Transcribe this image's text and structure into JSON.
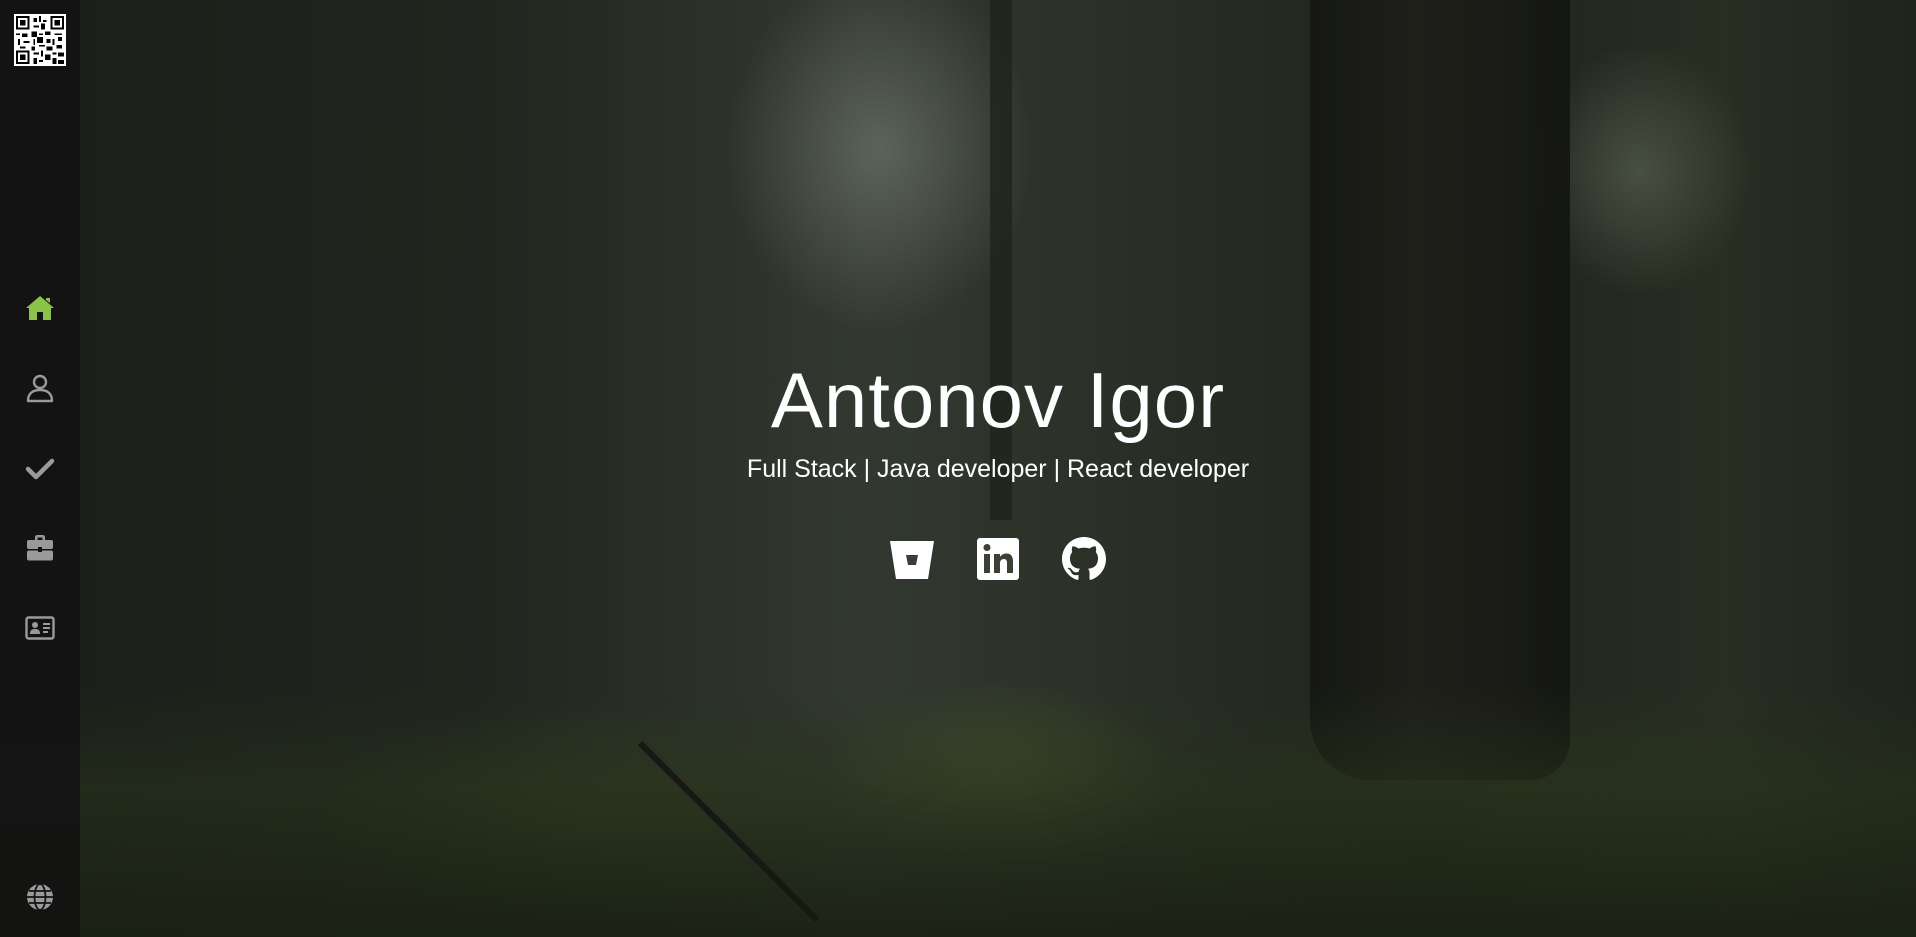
{
  "theme": {
    "accent": "#8bc34a",
    "sidebar_bg": "#121212",
    "icon_color": "#9a9a9a",
    "text_color": "#ffffff"
  },
  "sidebar": {
    "qr_code": "qr-code-icon",
    "items": [
      {
        "id": "home",
        "icon": "home-icon",
        "active": true
      },
      {
        "id": "about",
        "icon": "user-icon",
        "active": false
      },
      {
        "id": "skills",
        "icon": "check-icon",
        "active": false
      },
      {
        "id": "portfolio",
        "icon": "briefcase-icon",
        "active": false
      },
      {
        "id": "contact",
        "icon": "contact-card-icon",
        "active": false
      }
    ],
    "language": "globe-icon"
  },
  "hero": {
    "name": "Antonov Igor",
    "subtitle": "Full Stack | Java developer | React developer"
  },
  "socials": [
    {
      "id": "bitbucket",
      "icon": "bitbucket-icon"
    },
    {
      "id": "linkedin",
      "icon": "linkedin-icon"
    },
    {
      "id": "github",
      "icon": "github-icon"
    }
  ]
}
